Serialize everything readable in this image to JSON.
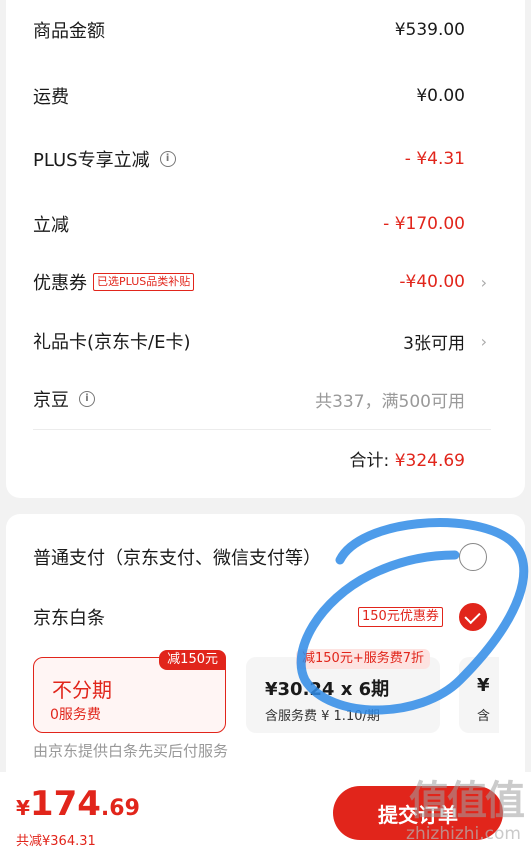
{
  "summary": {
    "goods_label": "商品金额",
    "goods_value": "¥539.00",
    "shipping_label": "运费",
    "shipping_value": "¥0.00",
    "plus_label": "PLUS专享立减",
    "plus_value": "- ¥4.31",
    "discount_label": "立减",
    "discount_value": "- ¥170.00",
    "coupon_label": "优惠券",
    "coupon_tag": "已选PLUS品类补贴",
    "coupon_value": "-¥40.00",
    "giftcard_label": "礼品卡(京东卡/E卡)",
    "giftcard_value": "3张可用",
    "jingdou_label": "京豆",
    "jingdou_value": "共337，满500可用",
    "total_label": "合计:",
    "total_value": "¥324.69"
  },
  "payment": {
    "normal_label": "普通支付（京东支付、微信支付等）",
    "baitiao_label": "京东白条",
    "baitiao_coupon": "150元优惠券",
    "options": [
      {
        "badge": "减150元",
        "title": "不分期",
        "sub": "0服务费"
      },
      {
        "badge": "减150元+服务费7折",
        "title": "¥30.24 x 6期",
        "sub": "含服务费 ¥ 1.10/期"
      },
      {
        "title": "¥",
        "sub": "含"
      }
    ],
    "note": "由京东提供白条先买后付服务"
  },
  "footer": {
    "price_symbol": "¥",
    "price_int": "174",
    "price_dec": ".69",
    "saved": "共减¥364.31",
    "submit_label": "提交订单"
  },
  "watermark": {
    "text": "值值值",
    "site": "zhizhizhi.com"
  },
  "colors": {
    "accent": "#e1251b",
    "annotation": "#2f8be6"
  }
}
